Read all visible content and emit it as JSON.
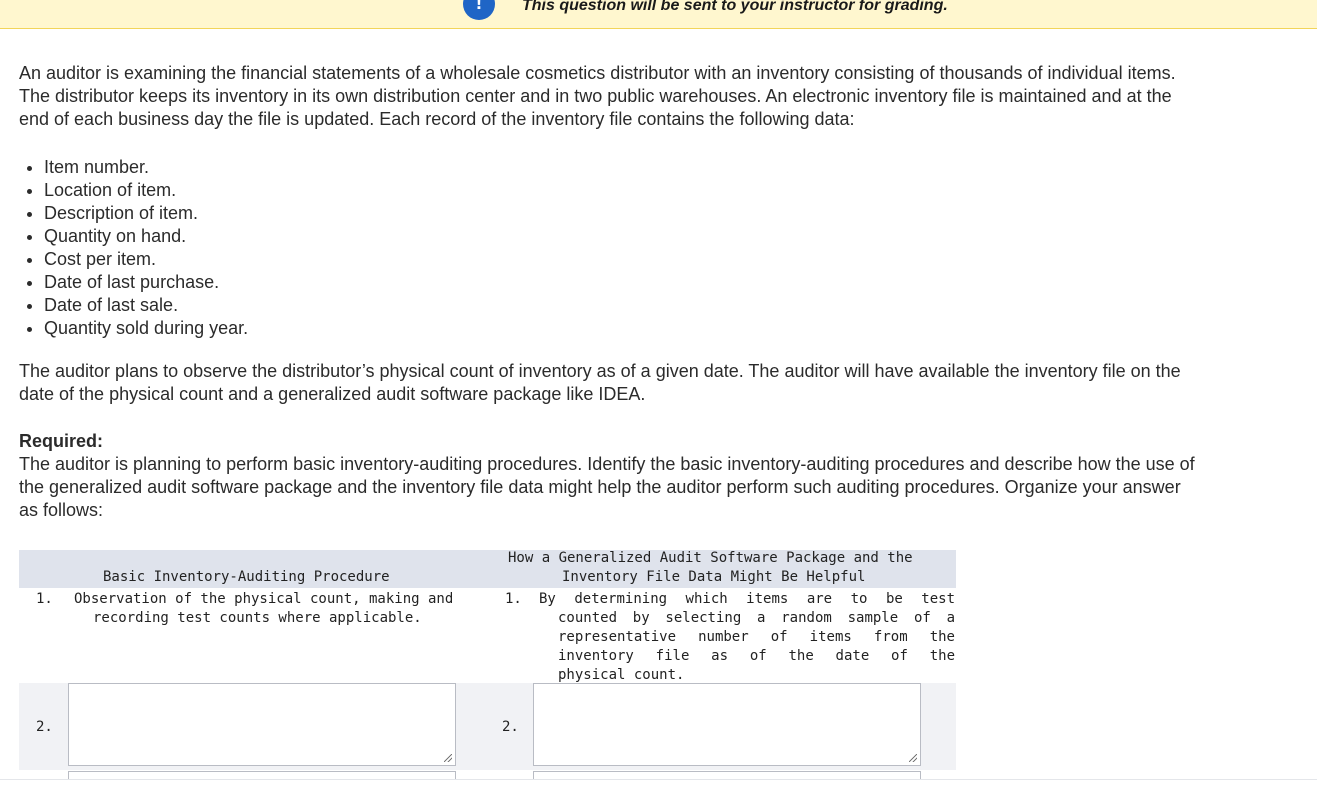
{
  "banner": {
    "icon": "exclamation-icon",
    "text": "This question will be sent to your instructor for grading."
  },
  "question": {
    "intro": "An auditor is examining the financial statements of a wholesale cosmetics distributor with an inventory consisting of thousands of individual items. The distributor keeps its inventory in its own distribution center and in two public warehouses. An electronic inventory file is maintained and at the end of each business day the file is updated. Each record of the inventory file contains the following data:",
    "data_items": [
      "Item number.",
      "Location of item.",
      "Description of item.",
      "Quantity on hand.",
      "Cost per item.",
      "Date of last purchase.",
      "Date of last sale.",
      "Quantity sold during year."
    ],
    "plan": "The auditor plans to observe the distributor’s physical count of inventory as of a given date. The auditor will have available the inventory file on the date of the physical count and a generalized audit software package like IDEA.",
    "required_label": "Required:",
    "required_text": "The auditor is planning to perform basic inventory-auditing procedures. Identify the basic inventory-auditing procedures and describe how the use of the generalized audit software package and the inventory file data might help the auditor perform such auditing procedures. Organize your answer as follows:"
  },
  "table": {
    "header_left": "Basic Inventory-Auditing Procedure",
    "header_right_line1": "How a Generalized Audit Software Package and the",
    "header_right_line2": "Inventory File Data Might Be Helpful",
    "row1": {
      "num_left": "1.",
      "left_line1": "Observation of the physical count, making and",
      "left_line2": "recording test counts where applicable.",
      "num_right": "1.",
      "right_lines": [
        "By determining which items are to be test",
        "counted by selecting a random sample of a",
        "representative number of items from the",
        "inventory file as of the date of the",
        "physical count."
      ]
    },
    "row2": {
      "num_left": "2.",
      "num_right": "2.",
      "left_value": "",
      "right_value": ""
    }
  }
}
